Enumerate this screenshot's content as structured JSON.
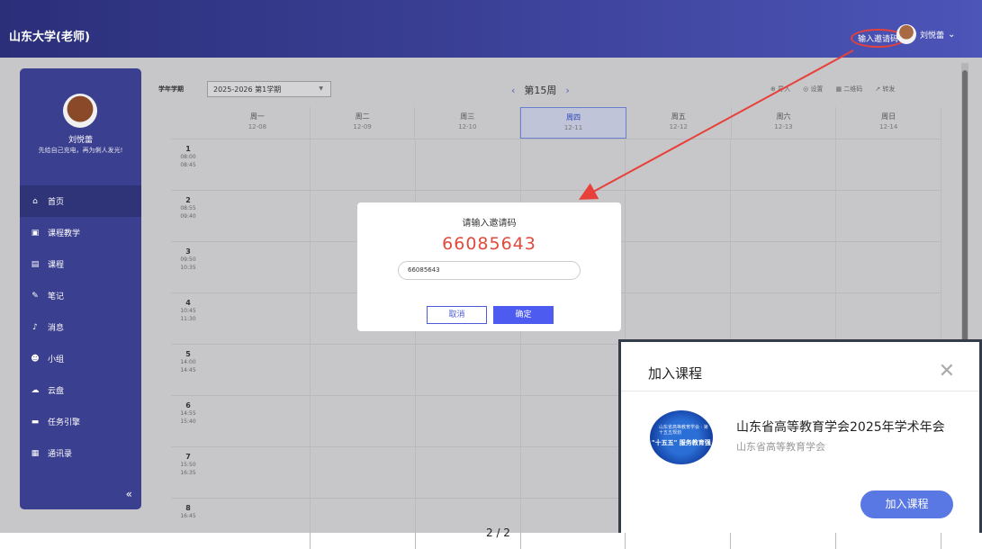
{
  "app": {
    "title": "山东大学(老师)",
    "invite_button": "输入邀请码",
    "user_name": "刘悦蕾"
  },
  "sidebar": {
    "name": "刘悦蕾",
    "motto": "先给自己充电，再为俐人发光!",
    "items": [
      {
        "icon": "home-icon",
        "label": "首页"
      },
      {
        "icon": "course-teaching-icon",
        "label": "课程教学"
      },
      {
        "icon": "course-icon",
        "label": "课程"
      },
      {
        "icon": "notes-icon",
        "label": "笔记"
      },
      {
        "icon": "bell-icon",
        "label": "消息"
      },
      {
        "icon": "group-icon",
        "label": "小组"
      },
      {
        "icon": "cloud-icon",
        "label": "云盘"
      },
      {
        "icon": "task-icon",
        "label": "任务引擎"
      },
      {
        "icon": "contacts-icon",
        "label": "通讯录"
      }
    ],
    "collapse": "«"
  },
  "filter": {
    "label": "学年学期",
    "term": "2025-2026 第1学期",
    "week": "第15周",
    "tools": [
      "导入",
      "设置",
      "二维码",
      "转发"
    ]
  },
  "schedule": {
    "days": [
      {
        "name": "周一",
        "date": "12-08"
      },
      {
        "name": "周二",
        "date": "12-09"
      },
      {
        "name": "周三",
        "date": "12-10"
      },
      {
        "name": "周四",
        "date": "12-11",
        "today": true
      },
      {
        "name": "周五",
        "date": "12-12"
      },
      {
        "name": "周六",
        "date": "12-13"
      },
      {
        "name": "周日",
        "date": "12-14"
      }
    ],
    "periods": [
      {
        "num": "1",
        "start": "08:00",
        "end": "08:45"
      },
      {
        "num": "2",
        "start": "08:55",
        "end": "09:40"
      },
      {
        "num": "3",
        "start": "09:50",
        "end": "10:35"
      },
      {
        "num": "4",
        "start": "10:45",
        "end": "11:30"
      },
      {
        "num": "5",
        "start": "14:00",
        "end": "14:45"
      },
      {
        "num": "6",
        "start": "14:55",
        "end": "15:40"
      },
      {
        "num": "7",
        "start": "15:50",
        "end": "16:35"
      },
      {
        "num": "8",
        "start": "16:45",
        "end": ""
      }
    ]
  },
  "invite_dialog": {
    "title": "请输入邀请码",
    "code": "66085643",
    "input_value": "66085643",
    "cancel": "取消",
    "confirm": "确定"
  },
  "join_card": {
    "title": "加入课程",
    "course_name": "山东省高等教育学会2025年学术年会",
    "org": "山东省高等教育学会",
    "logo_text_small": "山东省高等教育学会 · 第十五五规划",
    "logo_text_main": "\"十五五\" 服务教育强",
    "button": "加入课程"
  },
  "page_indicator": "2 / 2",
  "colors": {
    "accent": "#4e5bf0",
    "highlight": "#e14a3c",
    "sidebar": "#3b3f8f"
  }
}
